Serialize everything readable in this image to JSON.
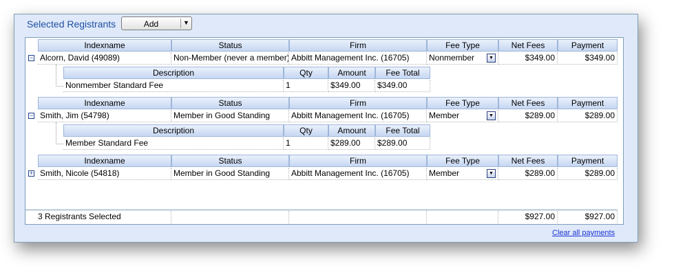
{
  "panel": {
    "title": "Selected Registrants",
    "add_button": "Add",
    "clear_link": "Clear all payments"
  },
  "grid": {
    "columns": [
      "Indexname",
      "Status",
      "Firm",
      "Fee Type",
      "Net Fees",
      "Payment"
    ],
    "sub_columns": [
      "Description",
      "Qty",
      "Amount",
      "Fee Total"
    ],
    "registrants": [
      {
        "indexname": "Alcorn, David (49089)",
        "status": "Non-Member (never a member)",
        "firm": "Abbitt Management Inc.  (16705)",
        "fee_type": "Nonmember",
        "net_fees": "$349.00",
        "payment": "$349.00",
        "expanded": true,
        "fees": [
          {
            "description": "Nonmember Standard Fee",
            "qty": "1",
            "amount": "$349.00",
            "fee_total": "$349.00"
          }
        ]
      },
      {
        "indexname": "Smith, Jim (54798)",
        "status": "Member in Good Standing",
        "firm": "Abbitt Management Inc.  (16705)",
        "fee_type": "Member",
        "net_fees": "$289.00",
        "payment": "$289.00",
        "expanded": true,
        "fees": [
          {
            "description": "Member Standard Fee",
            "qty": "1",
            "amount": "$289.00",
            "fee_total": "$289.00"
          }
        ]
      },
      {
        "indexname": "Smith, Nicole (54818)",
        "status": "Member in Good Standing",
        "firm": "Abbitt Management Inc.  (16705)",
        "fee_type": "Member",
        "net_fees": "$289.00",
        "payment": "$289.00",
        "expanded": false,
        "fees": []
      }
    ],
    "footer": {
      "count": "3 Registrants Selected",
      "net_total": "$927.00",
      "payment_total": "$927.00"
    }
  },
  "icons": {
    "collapse": "minus-box-icon",
    "expand": "plus-box-icon",
    "dropdown": "chevron-down-icon"
  },
  "colors": {
    "panel_bg": "#dfe9f9",
    "header_bg": "#c6d7f2",
    "title": "#1f4fa3",
    "link": "#1a33d6"
  }
}
